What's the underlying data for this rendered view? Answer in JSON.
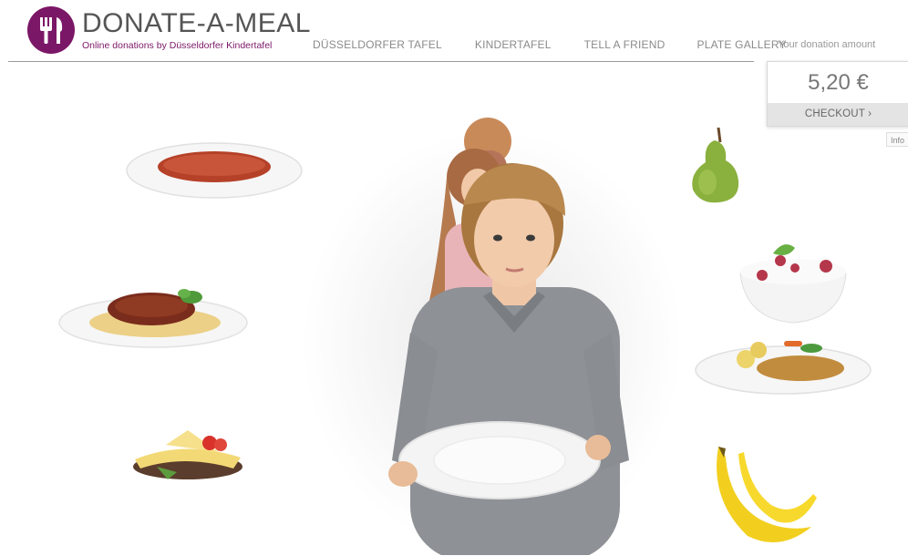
{
  "brand": {
    "title": "DONATE-A-MEAL",
    "subtitle": "Online donations by Düsseldorfer Kindertafel",
    "color": "#7b1767"
  },
  "nav": {
    "items": [
      {
        "label": "DÜSSELDORFER TAFEL"
      },
      {
        "label": "KINDERTAFEL"
      },
      {
        "label": "TELL A FRIEND"
      },
      {
        "label": "PLATE GALLERY"
      }
    ]
  },
  "donation": {
    "label": "Your donation amount",
    "amount": "5,20 €",
    "checkout_label": "CHECKOUT ›",
    "info_label": "Info"
  },
  "foods": [
    {
      "icon": "soup-plate-icon"
    },
    {
      "icon": "spaghetti-plate-icon"
    },
    {
      "icon": "sandwich-icon"
    },
    {
      "icon": "pear-icon"
    },
    {
      "icon": "yogurt-bowl-icon"
    },
    {
      "icon": "schnitzel-plate-icon"
    },
    {
      "icon": "bananas-icon"
    }
  ],
  "hero": {
    "icon": "children-with-empty-plate-image"
  }
}
